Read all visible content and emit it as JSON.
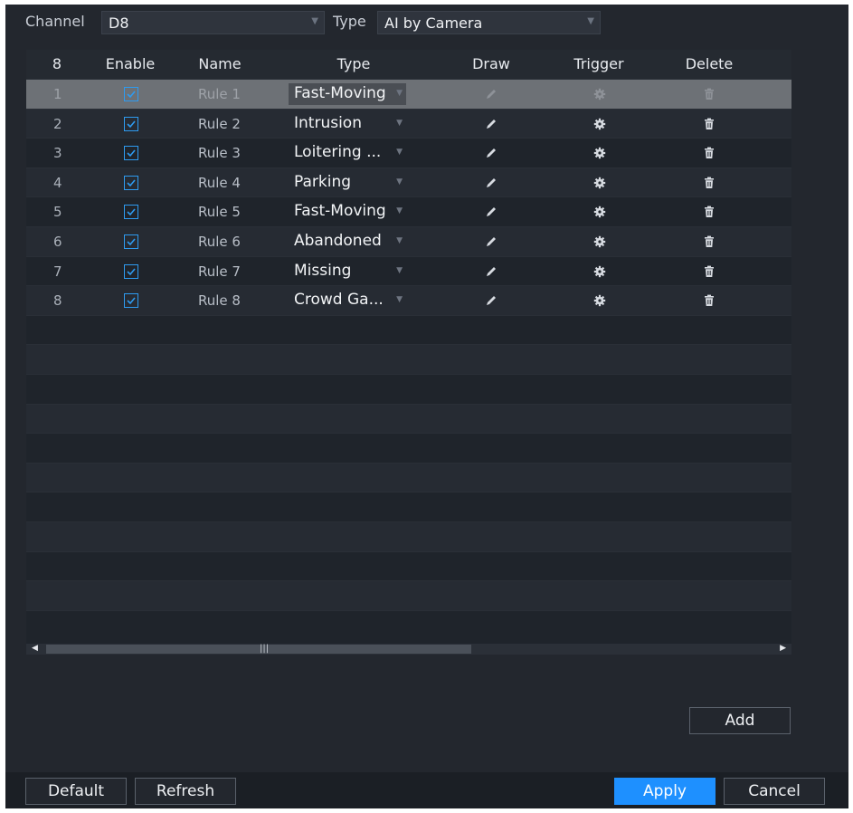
{
  "header": {
    "channel_label": "Channel",
    "channel_value": "D8",
    "type_label": "Type",
    "type_value": "AI by Camera"
  },
  "table": {
    "columns": [
      "8",
      "Enable",
      "Name",
      "Type",
      "Draw",
      "Trigger",
      "Delete"
    ],
    "rows": [
      {
        "num": "1",
        "enabled": true,
        "name": "Rule 1",
        "type": "Fast-Moving",
        "selected": true
      },
      {
        "num": "2",
        "enabled": true,
        "name": "Rule 2",
        "type": "Intrusion"
      },
      {
        "num": "3",
        "enabled": true,
        "name": "Rule 3",
        "type": "Loitering ..."
      },
      {
        "num": "4",
        "enabled": true,
        "name": "Rule 4",
        "type": "Parking"
      },
      {
        "num": "5",
        "enabled": true,
        "name": "Rule 5",
        "type": "Fast-Moving"
      },
      {
        "num": "6",
        "enabled": true,
        "name": "Rule 6",
        "type": "Abandoned"
      },
      {
        "num": "7",
        "enabled": true,
        "name": "Rule 7",
        "type": "Missing"
      },
      {
        "num": "8",
        "enabled": true,
        "name": "Rule 8",
        "type": "Crowd Ga..."
      }
    ]
  },
  "buttons": {
    "add": "Add",
    "default": "Default",
    "refresh": "Refresh",
    "apply": "Apply",
    "cancel": "Cancel"
  },
  "icons": {
    "checkbox": "check-icon",
    "draw": "pencil-icon",
    "trigger": "gear-icon",
    "delete": "trash-icon",
    "dropdown": "chevron-down-icon"
  },
  "colors": {
    "accent": "#1e90ff",
    "background": "#23272e",
    "selected_row": "#6d7176"
  }
}
